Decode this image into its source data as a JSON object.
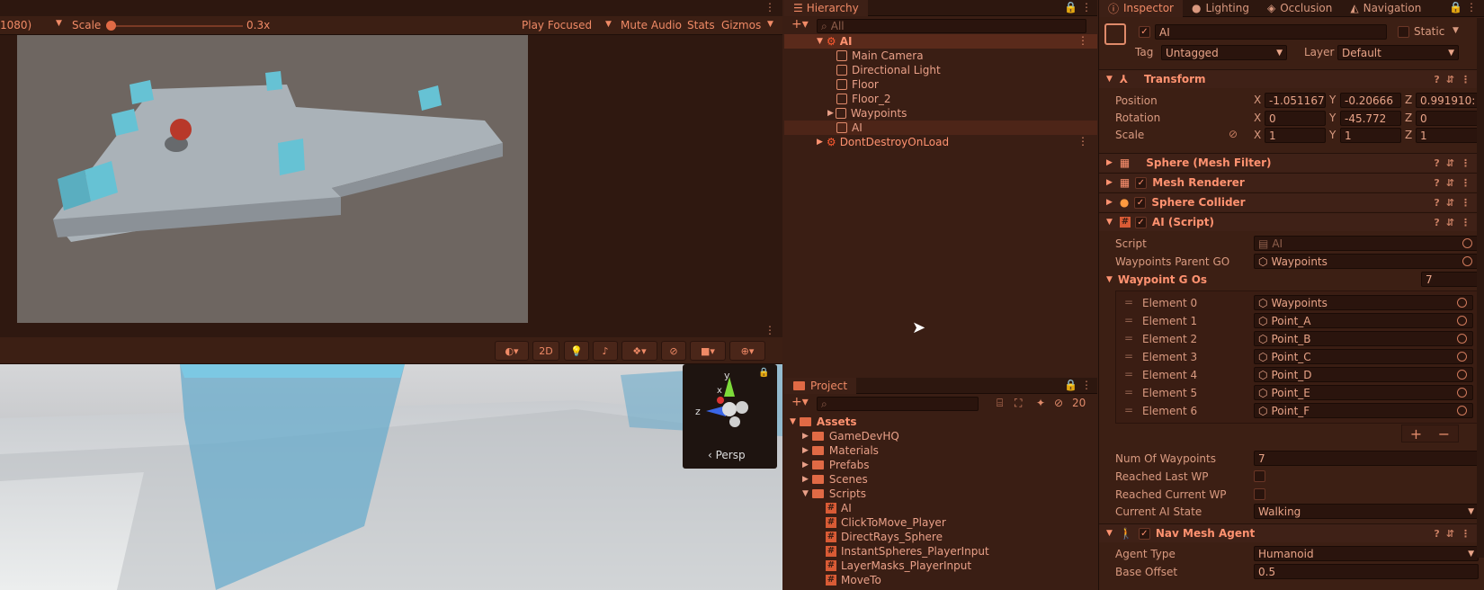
{
  "game_toolbar": {
    "resolution": "1080)",
    "scale_label": "Scale",
    "scale_value": "0.3x",
    "play_mode": "Play Focused",
    "mute": "Mute Audio",
    "stats": "Stats",
    "gizmos": "Gizmos"
  },
  "scene_toolbar": {
    "mode_2d": "2D",
    "gizmo_axes": {
      "y": "y",
      "x": "x",
      "z": "z"
    },
    "persp": "‹ Persp"
  },
  "hierarchy": {
    "title": "Hierarchy",
    "search_placeholder": "All",
    "items": [
      {
        "label": "AI"
      },
      {
        "label": "Main Camera"
      },
      {
        "label": "Directional Light"
      },
      {
        "label": "Floor"
      },
      {
        "label": "Floor_2"
      },
      {
        "label": "Waypoints"
      },
      {
        "label": "AI"
      },
      {
        "label": "DontDestroyOnLoad"
      }
    ]
  },
  "project": {
    "title": "Project",
    "hidden_count": "20",
    "items": [
      {
        "label": "Assets"
      },
      {
        "label": "GameDevHQ"
      },
      {
        "label": "Materials"
      },
      {
        "label": "Prefabs"
      },
      {
        "label": "Scenes"
      },
      {
        "label": "Scripts"
      },
      {
        "label": "AI"
      },
      {
        "label": "ClickToMove_Player"
      },
      {
        "label": "DirectRays_Sphere"
      },
      {
        "label": "InstantSpheres_PlayerInput"
      },
      {
        "label": "LayerMasks_PlayerInput"
      },
      {
        "label": "MoveTo"
      }
    ]
  },
  "inspector": {
    "tabs": {
      "inspector": "Inspector",
      "lighting": "Lighting",
      "occlusion": "Occlusion",
      "navigation": "Navigation"
    },
    "object_name": "AI",
    "static_label": "Static",
    "tag_label": "Tag",
    "tag_value": "Untagged",
    "layer_label": "Layer",
    "layer_value": "Default",
    "transform": {
      "title": "Transform",
      "position_label": "Position",
      "rotation_label": "Rotation",
      "scale_label": "Scale",
      "x": "X",
      "y": "Y",
      "z": "Z",
      "position": [
        "-1.051167",
        "-0.20666",
        "0.991910:"
      ],
      "rotation": [
        "0",
        "-45.772",
        "0"
      ],
      "scale": [
        "1",
        "1",
        "1"
      ]
    },
    "components": {
      "mesh_filter": "Sphere (Mesh Filter)",
      "mesh_renderer": "Mesh Renderer",
      "sphere_collider": "Sphere Collider",
      "ai_script": "AI (Script)",
      "nav_mesh_agent": "Nav Mesh Agent"
    },
    "ai": {
      "script_label": "Script",
      "script_value": "AI",
      "parent_label": "Waypoints Parent GO",
      "parent_value": "Waypoints",
      "list_label": "Waypoint G Os",
      "list_count": "7",
      "elements": [
        {
          "label": "Element 0",
          "value": "Waypoints"
        },
        {
          "label": "Element 1",
          "value": "Point_A"
        },
        {
          "label": "Element 2",
          "value": "Point_B"
        },
        {
          "label": "Element 3",
          "value": "Point_C"
        },
        {
          "label": "Element 4",
          "value": "Point_D"
        },
        {
          "label": "Element 5",
          "value": "Point_E"
        },
        {
          "label": "Element 6",
          "value": "Point_F"
        }
      ],
      "num_label": "Num Of Waypoints",
      "num_value": "7",
      "reached_last_label": "Reached Last WP",
      "reached_current_label": "Reached Current WP",
      "state_label": "Current AI State",
      "state_value": "Walking"
    },
    "nav": {
      "agent_type_label": "Agent Type",
      "agent_type_value": "Humanoid",
      "base_offset_label": "Base Offset",
      "base_offset_value": "0.5"
    }
  }
}
